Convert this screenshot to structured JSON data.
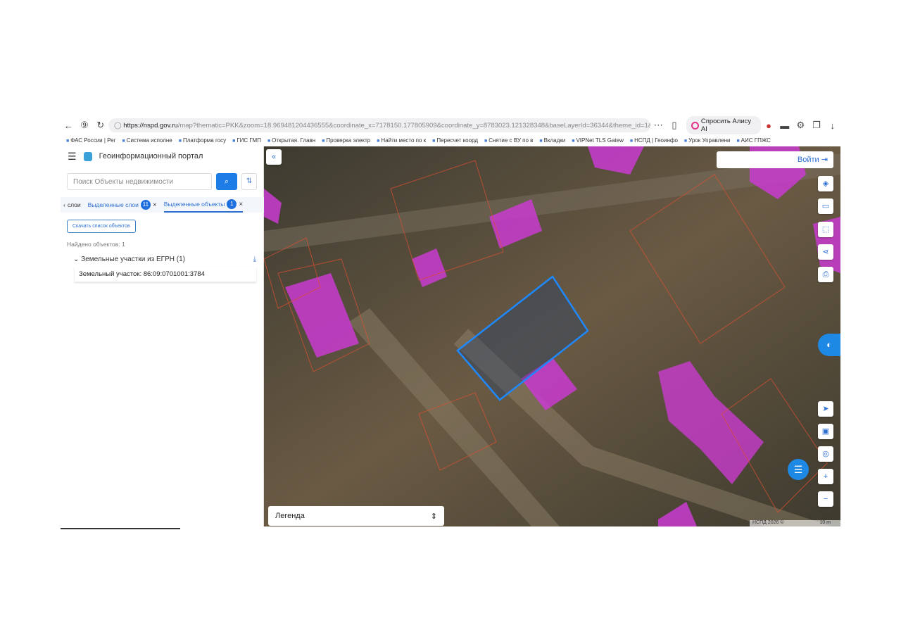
{
  "browser": {
    "url_host": "https://nspd.gov.ru",
    "url_rest": "/map?thematic=PKK&zoom=18.969481204436555&coordinate_x=7178150.177805909&coordinate_y=8783023.121328348&baseLayerId=36344&theme_id=1&i...",
    "alice_label": "Спросить Алису AI",
    "bookmarks": [
      "ФАС России | Рег",
      "Система исполне",
      "Платформа госу",
      "ГИС ГМП",
      "Открытая. Главн",
      "Проверка электр",
      "Найти место по к",
      "Пересчет коорд",
      "Снятие с ВУ по в",
      "Вкладки",
      "VIPNet TLS Gatew",
      "НСПД | Геоинфо",
      "Урок Управлени",
      "АИС ГПЖС"
    ]
  },
  "panel": {
    "title": "Геоинформационный портал",
    "search_placeholder": "Поиск Объекты недвижимости",
    "tabs": [
      {
        "label": "слои"
      },
      {
        "label": "Выделенные слои",
        "count": "11"
      },
      {
        "label": "Выделенные объекты",
        "count": "1"
      }
    ],
    "download_list": "Скачать список объектов",
    "found": "Найдено объектов: 1",
    "group": "Земельные участки из ЕГРН (1)",
    "item": "Земельный участок: 86:09:0701001:3784"
  },
  "map": {
    "login": "Войти",
    "legend": "Легенда",
    "attribution": "НСПД 2026 ©",
    "scale": "10 m",
    "colors": {
      "building": "#c93bd0",
      "selected": "#1e88ff",
      "parcel": "#e05030"
    }
  }
}
